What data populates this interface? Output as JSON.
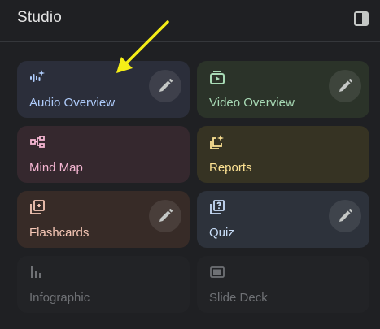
{
  "header": {
    "title": "Studio",
    "panel_icon": "dock-right-icon"
  },
  "cards": [
    {
      "label": "Audio Overview",
      "icon": "audio-spark-icon",
      "editable": true,
      "color": "#aecbfa"
    },
    {
      "label": "Video Overview",
      "icon": "video-icon",
      "editable": true,
      "color": "#a8dab5"
    },
    {
      "label": "Mind Map",
      "icon": "mind-map-icon",
      "editable": false,
      "color": "#f4b5d1"
    },
    {
      "label": "Reports",
      "icon": "reports-icon",
      "editable": false,
      "color": "#fde293"
    },
    {
      "label": "Flashcards",
      "icon": "flashcards-icon",
      "editable": true,
      "color": "#f6c7b6"
    },
    {
      "label": "Quiz",
      "icon": "quiz-icon",
      "editable": true,
      "color": "#c9def9"
    },
    {
      "label": "Infographic",
      "icon": "bar-chart-icon",
      "editable": false,
      "disabled": true,
      "color": "#6f7175"
    },
    {
      "label": "Slide Deck",
      "icon": "slides-icon",
      "editable": false,
      "disabled": true,
      "color": "#6f7175"
    }
  ],
  "annotation": {
    "color": "#f5ee17"
  }
}
